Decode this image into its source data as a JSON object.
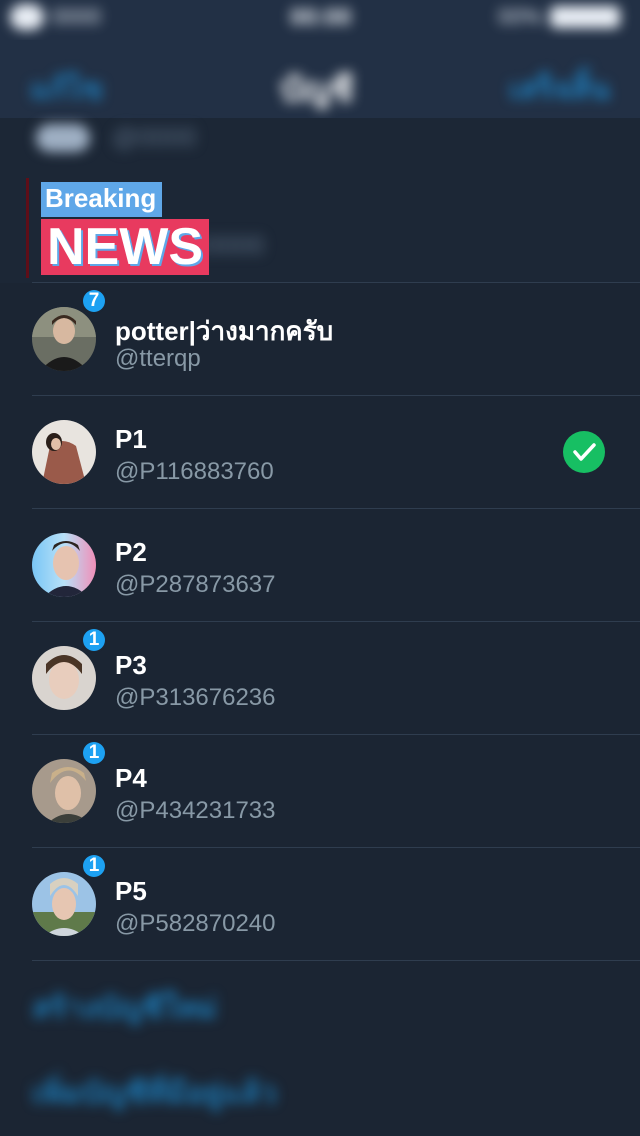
{
  "status_bar": {
    "carrier": "0000",
    "time": "00:00",
    "battery": "00%"
  },
  "nav": {
    "left": "แก้ไข",
    "title": "บัญชี",
    "right": "เสร็จสิ้น"
  },
  "blurred_top": {
    "t1": "@0000",
    "t2": "@0000"
  },
  "overlay": {
    "breaking": "Breaking",
    "news": "NEWS"
  },
  "accounts": [
    {
      "name": "potter|ว่างมากครับ",
      "handle": "@tterqp",
      "badge": "7",
      "selected": false
    },
    {
      "name": "P1",
      "handle": "@P116883760",
      "badge": "",
      "selected": true
    },
    {
      "name": "P2",
      "handle": "@P287873637",
      "badge": "",
      "selected": false
    },
    {
      "name": "P3",
      "handle": "@P313676236",
      "badge": "1",
      "selected": false
    },
    {
      "name": "P4",
      "handle": "@P434231733",
      "badge": "1",
      "selected": false
    },
    {
      "name": "P5",
      "handle": "@P582870240",
      "badge": "1",
      "selected": false
    }
  ],
  "footer": {
    "create": "สร้างบัญชีใหม่",
    "add": "เพิ่มบัญชีที่มีอยู่แล้ว"
  },
  "colors": {
    "background": "#1b2533",
    "accent": "#1da1f2",
    "check": "#17bf63",
    "handle": "#8899a6"
  },
  "icons": {
    "check": "check-icon"
  }
}
